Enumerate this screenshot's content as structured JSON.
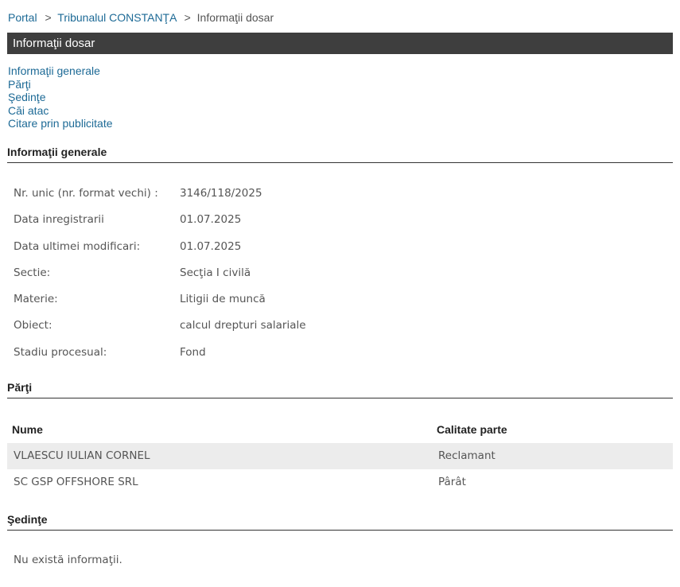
{
  "breadcrumb": {
    "sep": ">",
    "items": [
      {
        "label": "Portal"
      },
      {
        "label": "Tribunalul CONSTANŢA"
      },
      {
        "label": "Informaţii dosar"
      }
    ]
  },
  "page_title": "Informaţii dosar",
  "nav_links": [
    {
      "label": "Informaţii generale"
    },
    {
      "label": "Părţi"
    },
    {
      "label": "Şedinţe"
    },
    {
      "label": "Căi atac"
    },
    {
      "label": "Citare prin publicitate"
    }
  ],
  "general": {
    "heading": "Informaţii generale",
    "rows": [
      {
        "label": "Nr. unic (nr. format vechi) :",
        "value": "3146/118/2025"
      },
      {
        "label": "Data inregistrarii",
        "value": "01.07.2025"
      },
      {
        "label": "Data ultimei modificari:",
        "value": "01.07.2025"
      },
      {
        "label": "Sectie:",
        "value": "Secţia I civilă"
      },
      {
        "label": "Materie:",
        "value": "Litigii de muncă"
      },
      {
        "label": "Obiect:",
        "value": "calcul drepturi salariale"
      },
      {
        "label": "Stadiu procesual:",
        "value": "Fond"
      }
    ]
  },
  "parties": {
    "heading": "Părţi",
    "columns": {
      "name": "Nume",
      "role": "Calitate parte"
    },
    "rows": [
      {
        "name": "VLAESCU IULIAN CORNEL",
        "role": "Reclamant"
      },
      {
        "name": "SC GSP OFFSHORE SRL",
        "role": "Pârât"
      }
    ]
  },
  "hearings": {
    "heading": "Şedinţe",
    "empty_message": "Nu există informaţii."
  },
  "colors": {
    "link": "#1d6a96",
    "title_bar": "#3e3e3e",
    "row_alt": "#ececec"
  }
}
